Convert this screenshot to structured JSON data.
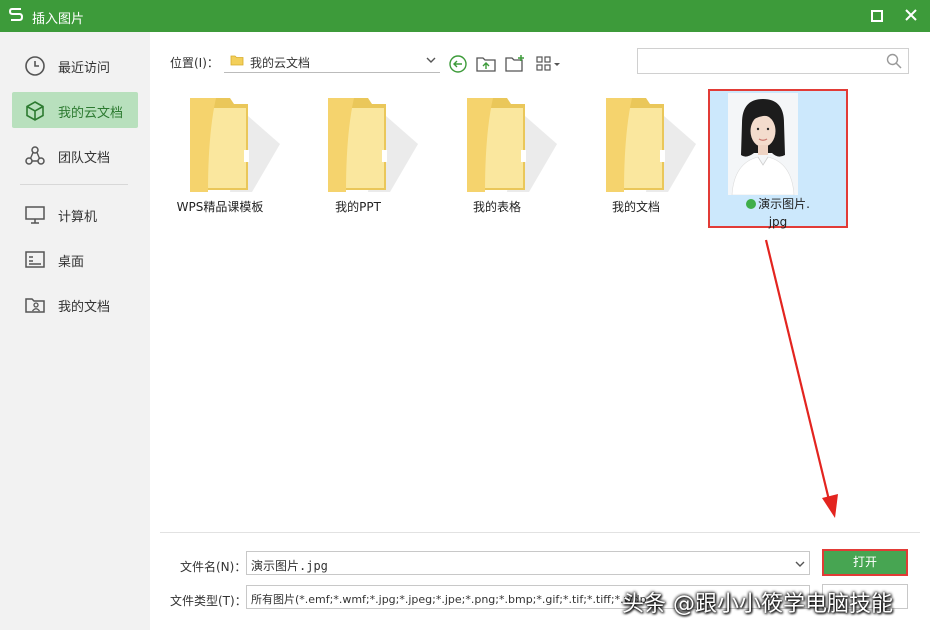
{
  "window": {
    "title": "插入图片",
    "accent_color": "#3d9b3a",
    "logo_icon": "wps-s-logo-icon",
    "maximize_icon": "maximize-icon",
    "close_icon": "close-icon"
  },
  "sidebar": {
    "items": [
      {
        "label": "最近访问",
        "icon": "clock-icon",
        "active": false
      },
      {
        "label": "我的云文档",
        "icon": "cube-icon",
        "active": true
      },
      {
        "label": "团队文档",
        "icon": "team-share-icon",
        "active": false
      },
      {
        "label": "计算机",
        "icon": "monitor-icon",
        "active": false
      },
      {
        "label": "桌面",
        "icon": "desktop-icon",
        "active": false
      },
      {
        "label": "我的文档",
        "icon": "user-folder-icon",
        "active": false
      }
    ],
    "active_color": "#b8e0bd"
  },
  "toolbar": {
    "location_label": "位置(I)：",
    "location_value": "我的云文档",
    "buttons": [
      "back-icon",
      "folder-up-icon",
      "new-folder-icon",
      "view-grid-icon"
    ]
  },
  "search": {
    "placeholder": "",
    "icon": "search-icon"
  },
  "files": [
    {
      "name": "WPS精品课模板",
      "type": "folder"
    },
    {
      "name": "我的PPT",
      "type": "folder"
    },
    {
      "name": "我的表格",
      "type": "folder"
    },
    {
      "name": "我的文档",
      "type": "folder"
    }
  ],
  "selected_file": {
    "name_line1": "演示图片.",
    "name_line2": "jpg",
    "status_icon": "synced-check-icon",
    "highlight_color": "#e23b36"
  },
  "bottom": {
    "filename_label": "文件名(N)：",
    "filename_value": "演示图片.jpg",
    "filetype_label": "文件类型(T)：",
    "filetype_value": "所有图片(*.emf;*.wmf;*.jpg;*.jpeg;*.jpe;*.png;*.bmp;*.gif;*.tif;*.tiff;*.wdp",
    "open_label": "打开",
    "open_color": "#47a552"
  },
  "watermark": "头条 @跟小小筱学电脑技能"
}
